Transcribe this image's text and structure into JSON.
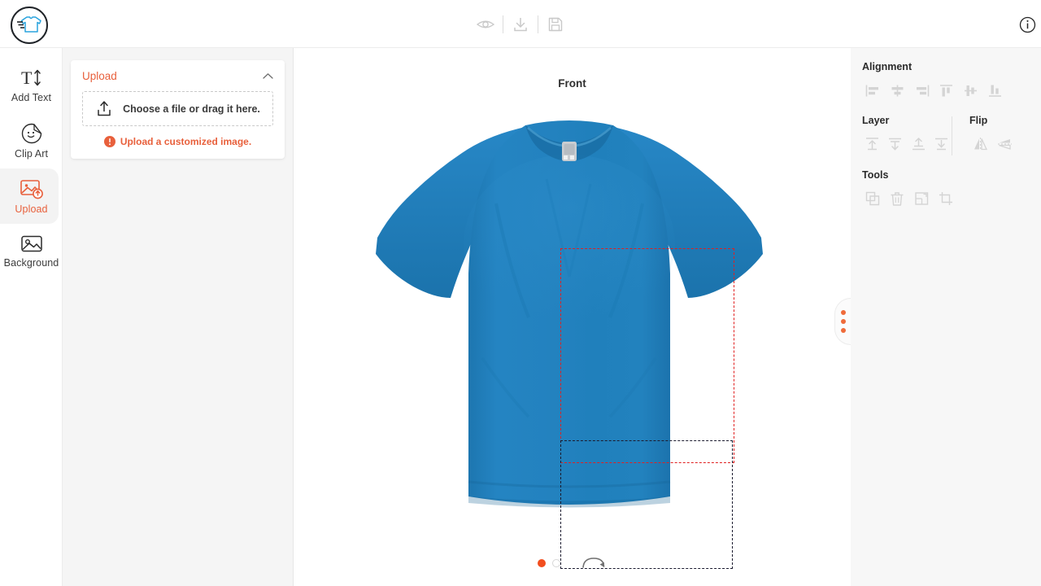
{
  "app": {
    "logo_name": "tshirt-designer-logo"
  },
  "topbar": {
    "tools": [
      {
        "name": "preview-icon",
        "label": "Preview"
      },
      {
        "name": "download-icon",
        "label": "Download"
      },
      {
        "name": "save-icon",
        "label": "Save"
      }
    ],
    "info_label": "Info"
  },
  "rail": {
    "items": [
      {
        "label": "Add Text",
        "icon": "add-text-icon",
        "active": false
      },
      {
        "label": "Clip Art",
        "icon": "clip-art-icon",
        "active": false
      },
      {
        "label": "Upload",
        "icon": "upload-image-icon",
        "active": true
      },
      {
        "label": "Background",
        "icon": "background-image-icon",
        "active": false
      }
    ]
  },
  "panel": {
    "upload": {
      "title": "Upload",
      "dropzone_text": "Choose a file or drag it here.",
      "error_text": "Upload a customized image.",
      "collapse_icon": "chevron-up-icon",
      "upload_arrow_icon": "upload-arrow-icon",
      "error_icon": "error-circle-icon"
    }
  },
  "canvas": {
    "view_label": "Front",
    "product_color": "#2281bd",
    "print_area_primary_color": "#e02020",
    "print_area_secondary_color": "#1b1b2f",
    "pagination": [
      {
        "name": "view-dot-front",
        "active": true
      },
      {
        "name": "view-dot-back",
        "active": false
      }
    ],
    "rotate_label": "Rotate view",
    "handle_label": "Toggle panel"
  },
  "right": {
    "alignment": {
      "title": "Alignment",
      "buttons": [
        {
          "name": "align-left-icon",
          "label": "Align left"
        },
        {
          "name": "align-center-horizontal-icon",
          "label": "Align center"
        },
        {
          "name": "align-right-icon",
          "label": "Align right"
        },
        {
          "name": "align-top-icon",
          "label": "Align top"
        },
        {
          "name": "align-middle-vertical-icon",
          "label": "Align middle"
        },
        {
          "name": "align-bottom-icon",
          "label": "Align bottom"
        }
      ]
    },
    "layer": {
      "title": "Layer",
      "buttons": [
        {
          "name": "bring-to-front-icon",
          "label": "Bring to front"
        },
        {
          "name": "send-to-back-icon",
          "label": "Send to back"
        },
        {
          "name": "bring-forward-icon",
          "label": "Bring forward"
        },
        {
          "name": "send-backward-icon",
          "label": "Send backward"
        }
      ]
    },
    "flip": {
      "title": "Flip",
      "buttons": [
        {
          "name": "flip-horizontal-icon",
          "label": "Flip horizontal"
        },
        {
          "name": "flip-vertical-icon",
          "label": "Flip vertical"
        }
      ]
    },
    "tools": {
      "title": "Tools",
      "buttons": [
        {
          "name": "duplicate-icon",
          "label": "Duplicate"
        },
        {
          "name": "delete-icon",
          "label": "Delete"
        },
        {
          "name": "resize-icon",
          "label": "Resize"
        },
        {
          "name": "crop-icon",
          "label": "Crop"
        }
      ]
    }
  }
}
